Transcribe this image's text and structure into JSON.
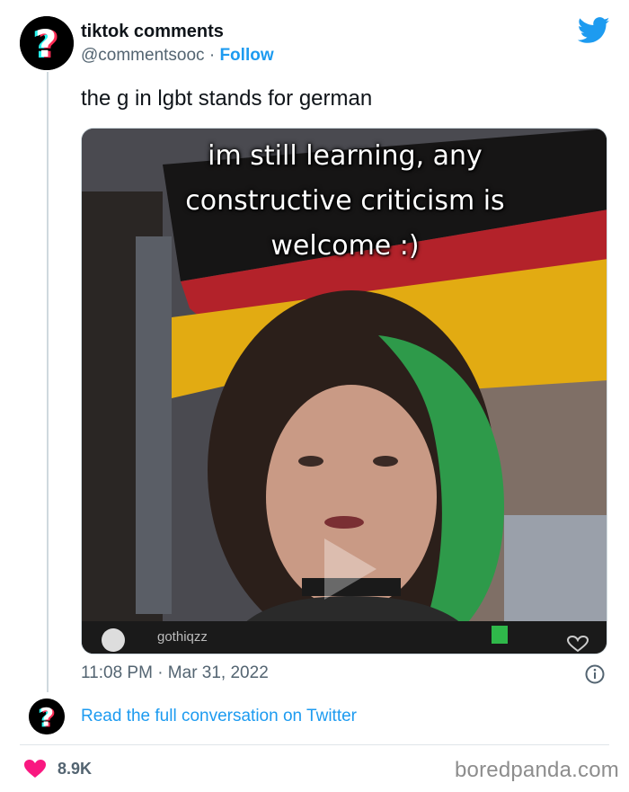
{
  "tweet": {
    "display_name": "tiktok comments",
    "handle": "@commentsooc",
    "separator": "·",
    "follow_label": "Follow",
    "text": "the g in lgbt stands for german",
    "timestamp": "11:08 PM · Mar 31, 2022",
    "conversation_link": "Read the full conversation on Twitter",
    "like_count": "8.9K"
  },
  "media": {
    "caption_lines": [
      "im still learning, any",
      "constructive criticism is",
      "welcome :)"
    ],
    "video_username": "gothiqzz"
  },
  "icons": {
    "avatar": "question-mark-icon",
    "brand": "twitter-bird-icon",
    "info": "info-icon",
    "like": "heart-icon",
    "play": "play-icon"
  },
  "colors": {
    "accent": "#1d9bf0",
    "like": "#f91880",
    "muted": "#536471"
  },
  "watermark": "boredpanda.com"
}
